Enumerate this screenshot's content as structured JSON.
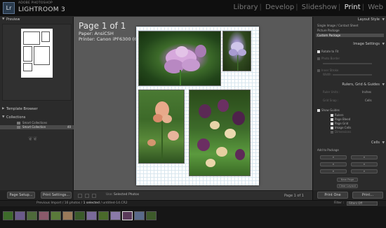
{
  "app": {
    "brand_small": "ADOBE PHOTOSHOP",
    "brand_main": "LIGHTROOM 3",
    "logo": "Lr"
  },
  "modules": [
    "Library",
    "Develop",
    "Slideshow",
    "Print",
    "Web"
  ],
  "active_module": "Print",
  "left_panel": {
    "preview_label": "Preview",
    "template_browser_label": "Template Browser",
    "collections_label": "Collections",
    "collections": [
      {
        "name": "Smart Collections",
        "count": ""
      },
      {
        "name": "Smart Collection",
        "count": "40"
      }
    ],
    "page_setup_label": "Page Setup...",
    "print_settings_label": "Print Settings..."
  },
  "page": {
    "title": "Page 1 of 1",
    "paper": "Paper:  AnsiCSH",
    "printer": "Printer:  Canon iPF6300 (6A3F26)"
  },
  "toolbar": {
    "use_label": "Use:",
    "use_value": "Selected Photos",
    "page_count": "Page 1 of 1"
  },
  "right_panel": {
    "layout_style_label": "Layout Style",
    "layout_options": [
      "Single Image / Contact Sheet",
      "Picture Package",
      "Custom Package"
    ],
    "selected_layout": "Custom Package",
    "image_settings_label": "Image Settings",
    "rotate_to_fit": "Rotate to Fit",
    "photo_border": "Photo Border",
    "inner_stroke": "Inner Stroke",
    "width_label": "Width",
    "rulers_label": "Rulers, Grid & Guides",
    "ruler_units_label": "Ruler Units :",
    "ruler_units_value": "Inches",
    "grid_snap_label": "Grid Snap :",
    "grid_snap_value": "Cells",
    "show_guides": "Show Guides",
    "guides": [
      "Rulers",
      "Page Bleed",
      "Page Grid",
      "Image Cells",
      "Dimensions"
    ],
    "cells_label": "Cells",
    "add_to_package": "Add to Package",
    "new_page": "New Page",
    "clear_layout": "Clear Layout",
    "print_one": "Print One",
    "print": "Print..."
  },
  "filmstrip": {
    "source": "Previous Import / 16 photos /",
    "selected": "1 selected",
    "file": "/ untitled-14.CR2",
    "filter_label": "Filter :",
    "filter_value": "Filters Off"
  },
  "colors": {
    "accent": "#e8e8e8",
    "panel": "#2b2b2b",
    "canvas": "#595959"
  }
}
